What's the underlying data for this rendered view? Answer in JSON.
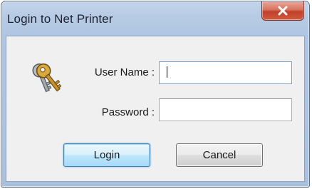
{
  "window": {
    "title": "Login to Net Printer",
    "close_icon": "close-icon"
  },
  "form": {
    "icon": "keys-icon",
    "username_label": "User Name :",
    "username_value": "",
    "password_label": "Password :",
    "password_value": ""
  },
  "buttons": {
    "login_label": "Login",
    "cancel_label": "Cancel"
  },
  "colors": {
    "titlebar": "#b7cbe4",
    "close_button": "#c7432c",
    "client_background": "#f0f0f0",
    "default_button_border": "#3c7fb1"
  }
}
